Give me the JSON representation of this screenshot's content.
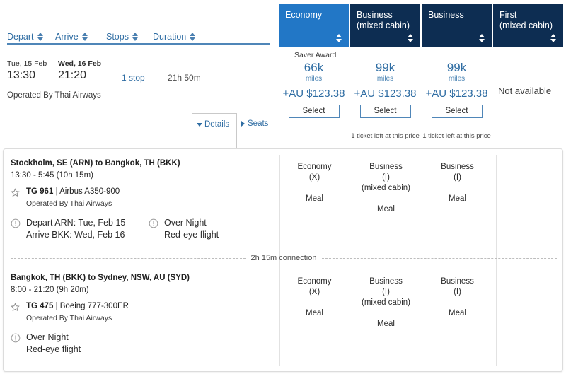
{
  "sort_columns": [
    {
      "label": "Depart",
      "icon": "sort-arrows-icon"
    },
    {
      "label": "Arrive",
      "icon": "sort-arrows-icon"
    },
    {
      "label": "Stops",
      "icon": "sort-arrows-icon"
    },
    {
      "label": "Duration",
      "icon": "sort-arrows-icon"
    }
  ],
  "cabin_tabs": [
    {
      "line1": "Economy",
      "line2": "",
      "active": true
    },
    {
      "line1": "Business",
      "line2": "(mixed cabin)",
      "active": false
    },
    {
      "line1": "Business",
      "line2": "",
      "active": false
    },
    {
      "line1": "First",
      "line2": "(mixed cabin)",
      "active": false
    }
  ],
  "flight_summary": {
    "depart_date": "Tue, 15 Feb",
    "depart_time": "13:30",
    "arrive_date": "Wed, 16 Feb",
    "arrive_time": "21:20",
    "stops": "1 stop",
    "duration": "21h 50m",
    "operated_by": "Operated By Thai Airways",
    "details_label": "Details",
    "seats_label": "Seats"
  },
  "fare_header": "Saver Award",
  "fares": [
    {
      "miles": "66k",
      "miles_label": "miles",
      "cash": "+AU $123.38",
      "select_label": "Select",
      "ticket_note": ""
    },
    {
      "miles": "99k",
      "miles_label": "miles",
      "cash": "+AU $123.38",
      "select_label": "Select",
      "ticket_note": "1 ticket left at this price"
    },
    {
      "miles": "99k",
      "miles_label": "miles",
      "cash": "+AU $123.38",
      "select_label": "Select",
      "ticket_note": "1 ticket left at this price"
    }
  ],
  "not_available": "Not available",
  "segments": [
    {
      "route": "Stockholm, SE (ARN) to Bangkok, TH (BKK)",
      "times": "13:30 - 5:45 (10h 15m)",
      "flight_no": "TG 961",
      "separator": "|",
      "aircraft": "Airbus A350-900",
      "operated_by": "Operated By Thai Airways",
      "notes": [
        {
          "line1": "Depart ARN: Tue, Feb 15",
          "line2": "Arrive BKK: Wed, Feb 16"
        },
        {
          "line1": "Over Night",
          "line2": "Red-eye flight"
        }
      ],
      "cabins": [
        {
          "line1": "Economy",
          "line2": "(X)",
          "line3": "",
          "meal": "Meal"
        },
        {
          "line1": "Business",
          "line2": "(I)",
          "line3": "(mixed cabin)",
          "meal": "Meal"
        },
        {
          "line1": "Business",
          "line2": "(I)",
          "line3": "",
          "meal": "Meal"
        }
      ]
    },
    {
      "route": "Bangkok, TH (BKK) to Sydney, NSW, AU (SYD)",
      "times": "8:00 - 21:20 (9h 20m)",
      "flight_no": "TG 475",
      "separator": "|",
      "aircraft": "Boeing 777-300ER",
      "operated_by": "Operated By Thai Airways",
      "notes": [
        {
          "line1": "Over Night",
          "line2": "Red-eye flight"
        }
      ],
      "cabins": [
        {
          "line1": "Economy",
          "line2": "(X)",
          "line3": "",
          "meal": "Meal"
        },
        {
          "line1": "Business",
          "line2": "(I)",
          "line3": "(mixed cabin)",
          "meal": "Meal"
        },
        {
          "line1": "Business",
          "line2": "(I)",
          "line3": "",
          "meal": "Meal"
        }
      ]
    }
  ],
  "connection": {
    "label": "2h 15m connection"
  },
  "colors": {
    "active_tab": "#2277c6",
    "tab": "#0d2d52",
    "link": "#2f6da3",
    "rule": "#4f86b8"
  }
}
